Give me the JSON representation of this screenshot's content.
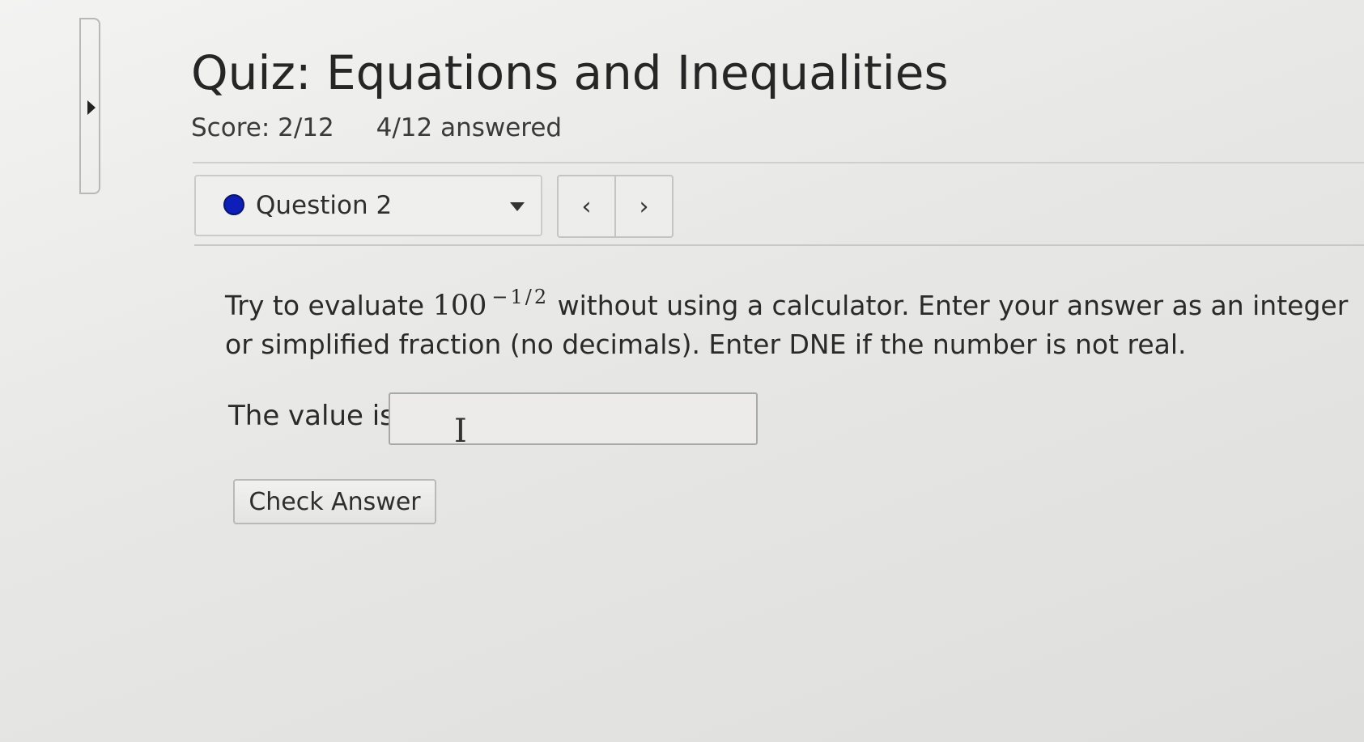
{
  "quiz": {
    "title": "Quiz: Equations and Inequalities",
    "score": "Score: 2/12",
    "answered": "4/12 answered"
  },
  "question_nav": {
    "selected": "Question 2",
    "prev_glyph": "‹",
    "next_glyph": "›",
    "status_color": "#0d1fb8"
  },
  "question": {
    "text_before": "Try to evaluate ",
    "base": "100",
    "exponent": "−1/2",
    "text_after": " without using a calculator. Enter your answer as an integer or simplified fraction (no decimals). Enter DNE if the number is not real."
  },
  "answer": {
    "label": "The value is",
    "value": ""
  },
  "actions": {
    "check_label": "Check Answer"
  }
}
